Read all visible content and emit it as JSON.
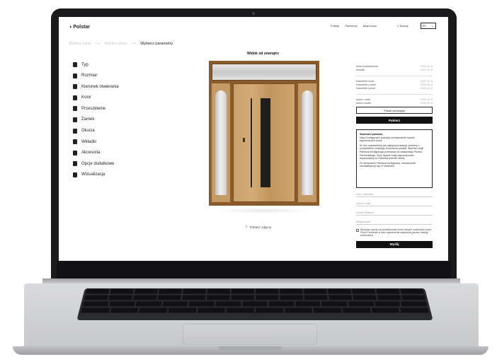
{
  "nav": {
    "logo": "Polstar",
    "links": [
      "Polstar",
      "Partnerzy",
      "Moje konto"
    ],
    "search_label": "Szukaj",
    "lang": "PL"
  },
  "breadcrumb": {
    "step1": "Wybierz panel",
    "step2": "Wybierz drzwi",
    "step3": "Wybierz parametry"
  },
  "menu": [
    {
      "label": "Typ",
      "icon": "type-icon"
    },
    {
      "label": "Rozmiar",
      "icon": "size-icon"
    },
    {
      "label": "Kierunek otwierania",
      "icon": "direction-icon"
    },
    {
      "label": "Kolor",
      "icon": "color-icon"
    },
    {
      "label": "Przeszklenie",
      "icon": "glazing-icon"
    },
    {
      "label": "Zamek",
      "icon": "lock-icon"
    },
    {
      "label": "Okucia",
      "icon": "fittings-icon"
    },
    {
      "label": "Wkładki",
      "icon": "insert-icon"
    },
    {
      "label": "Akcesoria",
      "icon": "accessories-icon"
    },
    {
      "label": "Opcje dodatkowe",
      "icon": "options-icon"
    },
    {
      "label": "Wizualizacja",
      "icon": "visualization-icon"
    }
  ],
  "preview": {
    "title": "Widok od zewnątrz",
    "download_label": "Pobierz zdjęcie"
  },
  "summary": {
    "rows1": [
      {
        "label": "drzwi podstawowe",
        "value": "0000.00 zł"
      },
      {
        "label": "dodatki",
        "value": "0000.00 zł"
      }
    ],
    "rows2": [
      {
        "label": "Naświetle lewe",
        "value": "0000.00 zł"
      },
      {
        "label": "Naświetle prawe",
        "value": "0000.00 zł"
      },
      {
        "label": "Naświetle górne",
        "value": "0000.00 zł"
      }
    ],
    "rows3": [
      {
        "label": "razem netto",
        "value": "0000.00 zł"
      },
      {
        "label": "razem brutto",
        "value": "0000.00 zł"
      }
    ],
    "details_button": "Pokaż szczegóły",
    "download_button": "Pobierz"
  },
  "notice": {
    "heading": "Szanowni państwo,",
    "text1": "Nasz Konfigurator pozwala na stworzenie swoich wymarzonych drzwi.",
    "text2": "W celu zapewnienia jak najlepszej obsługi, prosimy o uzupełnienie krótkiego formularza poniżej, abyśmy mogli Państwa konfigurację przekazać do właściwego Punktu Partnerskiego, który będzie mógł zaproponować dopasowaną do Państwa potrzeb ofertę.",
    "text3": "Po otrzymaniu Państwa konfiguracji, niezwłocznie skontaktujemy się z Państwem."
  },
  "form": {
    "name_placeholder": "Imię i nazwisko",
    "email_placeholder": "Adres e-mail",
    "phone_placeholder": "Numer telefonu",
    "city_placeholder": "Miejscowość",
    "consent": "Wyrażam zgodę na przetwarzanie moich danych osobowych przez Punkt Partnerski w celu zapewnienia najwyższej jakości obsługi zamówienia",
    "send_button": "Wyślij"
  },
  "colors": {
    "bezel": "#1b1b1d",
    "accent": "#111111",
    "wood": "#c9a16b",
    "frame": "#8a5a2b"
  }
}
